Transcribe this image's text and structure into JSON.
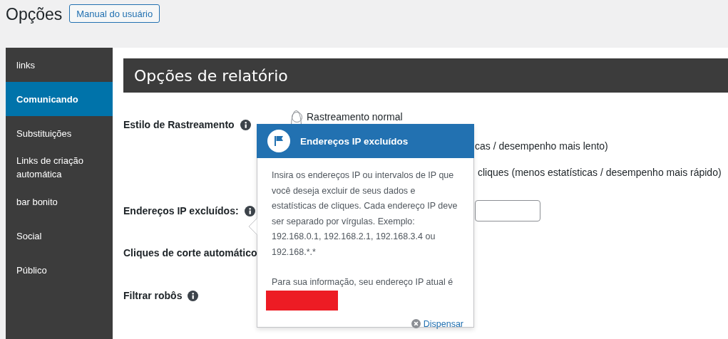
{
  "page": {
    "title": "Opções",
    "manual_button": "Manual do usuário"
  },
  "sidebar": {
    "items": [
      {
        "label": "links",
        "selected": false
      },
      {
        "label": "Comunicando",
        "selected": true
      },
      {
        "label": "Substituições",
        "selected": false
      },
      {
        "label": "Links de criação automática",
        "selected": false
      },
      {
        "label": "bar bonito",
        "selected": false
      },
      {
        "label": "Social",
        "selected": false
      },
      {
        "label": "Público",
        "selected": false
      }
    ]
  },
  "panel": {
    "heading": "Opções de relatório"
  },
  "fields": [
    {
      "label": "Estilo de Rastreamento",
      "info": true,
      "kind": "radios",
      "options": [
        {
          "kind": "radio",
          "label": "Rastreamento normal",
          "selected": false
        },
        {
          "kind": "fragment",
          "label": "cas / desempenho mais lento)"
        },
        {
          "kind": "fragment",
          "label": "cliques (menos estatísticas / desempenho mais rápido)"
        }
      ]
    },
    {
      "label": "Endereços IP excluídos:",
      "info": true,
      "kind": "input"
    },
    {
      "label": "Cliques de corte automático",
      "info": false,
      "kind": "none"
    },
    {
      "label": "Filtrar robôs",
      "info": true,
      "kind": "none"
    }
  ],
  "popover": {
    "title": "Endereços IP excluídos",
    "body": "Insira os endereços IP ou intervalos de IP que você deseja excluir de seus dados e estatísticas de cliques. Cada endereço IP deve ser separado por vírgulas. Exemplo: 192.168.0.1, 192.168.2.1, 192.168.3.4 ou 192.168.*.*",
    "note": "Para sua informação, seu endereço IP atual é",
    "dismiss": "Dispensar"
  }
}
